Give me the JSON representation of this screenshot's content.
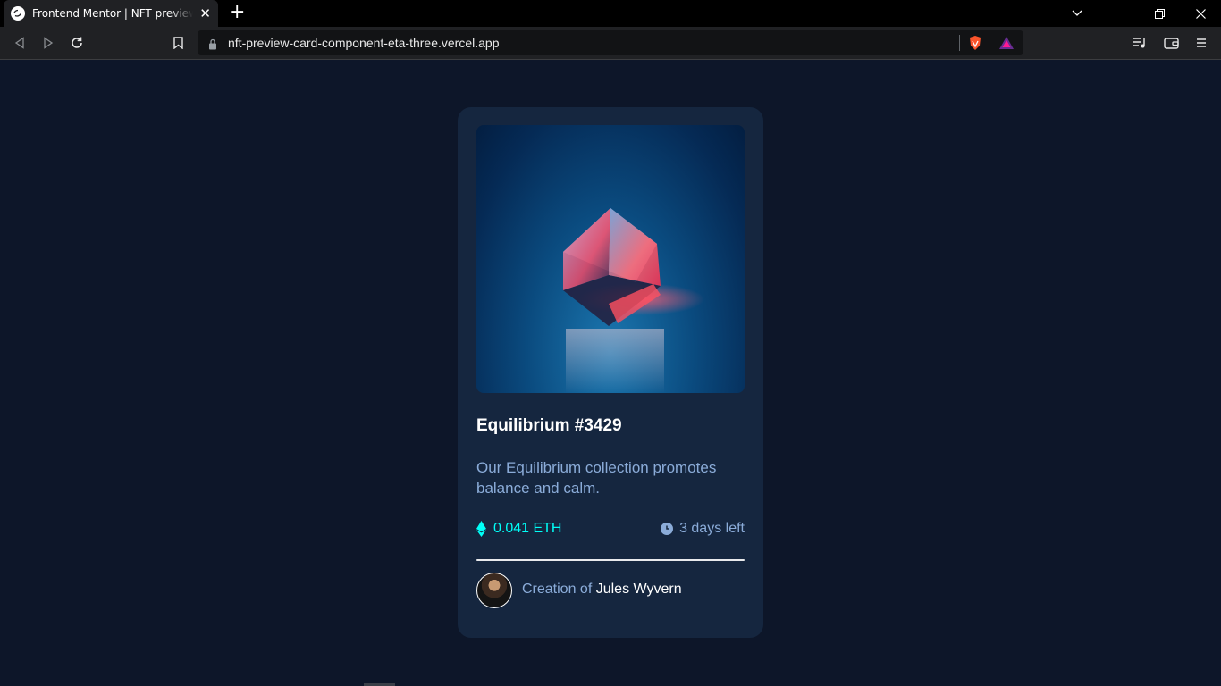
{
  "browser": {
    "tab_title": "Frontend Mentor | NFT preview card component",
    "url": "nft-preview-card-component-eta-three.vercel.app"
  },
  "card": {
    "title": "Equilibrium #3429",
    "description": "Our Equilibrium collection promotes balance and calm.",
    "price": "0.041 ETH",
    "time_left": "3 days left",
    "creator_label": "Creation of",
    "creator_name": "Jules Wyvern"
  },
  "colors": {
    "page_bg": "#0d1629",
    "card_bg": "#15263f",
    "accent_cyan": "#00fff8",
    "soft_blue": "#8bacd9",
    "white": "#ffffff"
  }
}
